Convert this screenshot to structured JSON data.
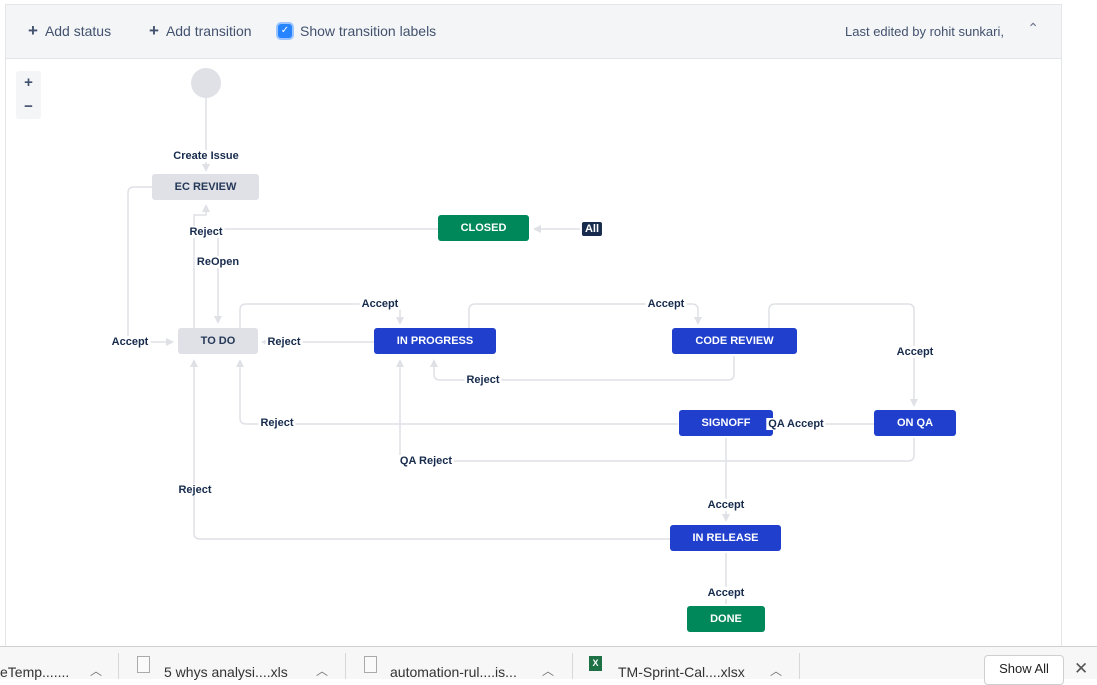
{
  "toolbar": {
    "add_status": "Add status",
    "add_transition": "Add transition",
    "show_labels": "Show transition labels",
    "show_labels_checked": true,
    "last_edited": "Last edited by rohit sunkari,"
  },
  "zoom_controls": {
    "zoom_in": "+",
    "zoom_out": "−"
  },
  "statuses": {
    "ec_review": "EC REVIEW",
    "closed": "CLOSED",
    "to_do": "TO DO",
    "in_progress": "IN PROGRESS",
    "code_review": "CODE REVIEW",
    "signoff": "SIGNOFF",
    "on_qa": "ON QA",
    "in_release": "IN RELEASE",
    "done": "DONE"
  },
  "status_categories": {
    "todo_color": "#dfe1e6",
    "inprogress_color": "#1f3fcc",
    "done_color": "#00875a"
  },
  "transitions": {
    "create_issue": "Create Issue",
    "ec_reject": "Reject",
    "reopen": "ReOpen",
    "all_label": "All",
    "ec_accept": "Accept",
    "todo_accept": "Accept",
    "inprog_reject": "Reject",
    "inprog_accept": "Accept",
    "code_reject": "Reject",
    "code_accept": "Accept",
    "signoff_reject": "Reject",
    "qa_accept": "QA Accept",
    "qa_reject": "QA Reject",
    "release_reject": "Reject",
    "signoff_accept": "Accept",
    "release_accept": "Accept"
  },
  "downloads": {
    "items": [
      {
        "name": "eTemp.......",
        "icon": "file-icon"
      },
      {
        "name": "5 whys analysi....xls",
        "icon": "file-icon"
      },
      {
        "name": "automation-rul....is...",
        "icon": "file-icon"
      },
      {
        "name": "TM-Sprint-Cal....xlsx",
        "icon": "excel-icon"
      }
    ],
    "show_all": "Show All"
  }
}
